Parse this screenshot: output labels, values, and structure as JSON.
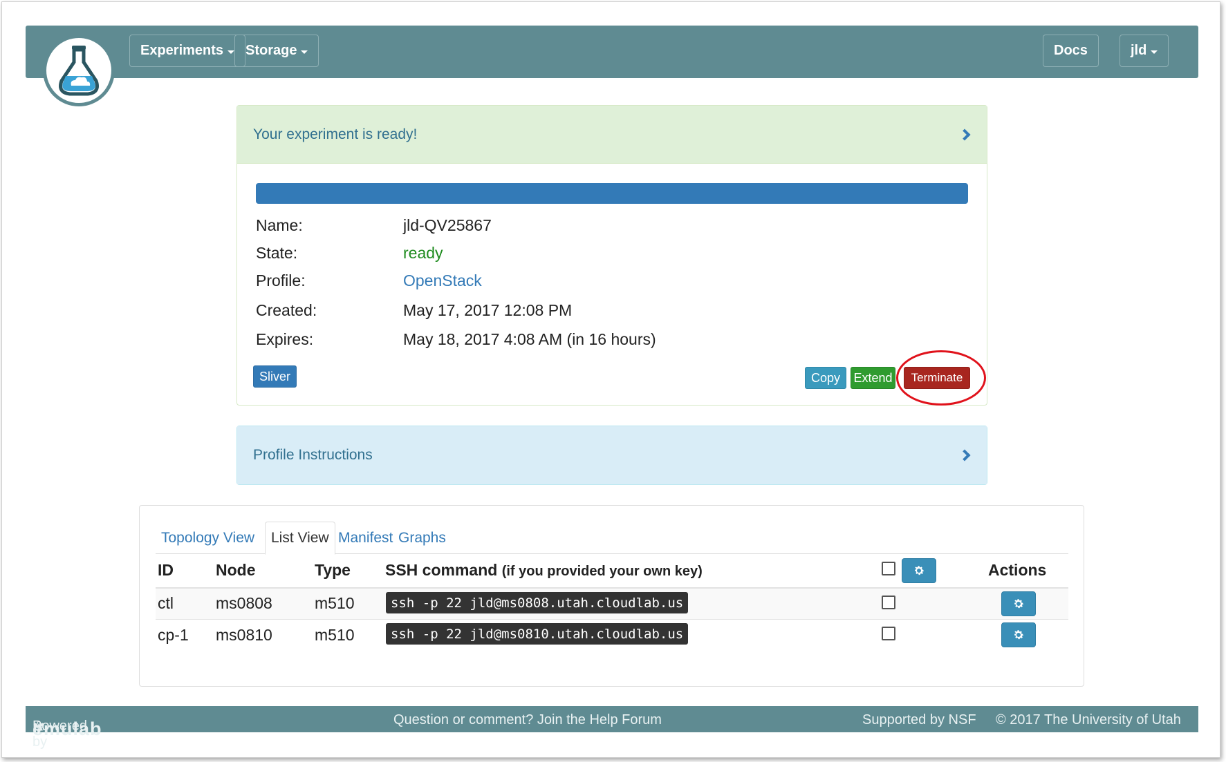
{
  "navbar": {
    "experiments_label": "Experiments",
    "storage_label": "Storage",
    "docs_label": "Docs",
    "user_label": "jld"
  },
  "ready_panel": {
    "heading": "Your experiment is ready!",
    "progress_percent": 100,
    "fields": {
      "name_label": "Name:",
      "name_value": "jld-QV25867",
      "state_label": "State:",
      "state_value": "ready",
      "profile_label": "Profile:",
      "profile_value": "OpenStack",
      "created_label": "Created:",
      "created_value": "May 17, 2017 12:08 PM",
      "expires_label": "Expires:",
      "expires_value": "May 18, 2017 4:08 AM (in 16 hours)"
    },
    "buttons": {
      "sliver": "Sliver",
      "copy": "Copy",
      "extend": "Extend",
      "terminate": "Terminate"
    }
  },
  "instructions_panel": {
    "heading": "Profile Instructions"
  },
  "list_panel": {
    "tabs": [
      "Topology View",
      "List View",
      "Manifest",
      "Graphs"
    ],
    "active_tab": "List View",
    "headers": {
      "id": "ID",
      "node": "Node",
      "type": "Type",
      "ssh": "SSH command",
      "ssh_note": "(if you provided your own key)",
      "actions": "Actions"
    },
    "rows": [
      {
        "id": "ctl",
        "node": "ms0808",
        "type": "m510",
        "ssh": "ssh -p 22 jld@ms0808.utah.cloudlab.us"
      },
      {
        "id": "cp-1",
        "node": "ms0810",
        "type": "m510",
        "ssh": "ssh -p 22 jld@ms0810.utah.cloudlab.us"
      }
    ]
  },
  "footer": {
    "powered_by": "Powered by",
    "emulab": "emulab",
    "help": "Question or comment? Join the Help Forum",
    "nsf": "Supported by NSF",
    "copyright": "© 2017 The University of Utah"
  },
  "colors": {
    "navbar": "#5f8b92",
    "primary": "#337ab7",
    "success": "#2f9b2f",
    "danger": "#a8261f",
    "info": "#3a9abd",
    "annotation": "#e0121b"
  }
}
